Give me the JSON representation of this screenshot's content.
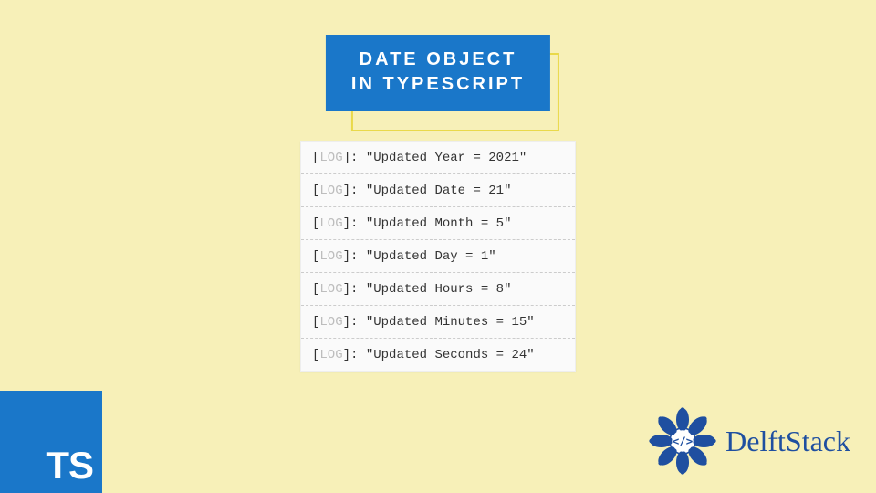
{
  "title": {
    "line1": "DATE OBJECT",
    "line2": "IN TYPESCRIPT"
  },
  "log_prefix_open": "[",
  "log_prefix_tag": "LOG",
  "log_prefix_close": "]",
  "log_colon": ": ",
  "logs": [
    "\"Updated Year = 2021\"",
    "\"Updated Date = 21\"",
    "\"Updated Month = 5\"",
    "\"Updated Day = 1\"",
    "\"Updated Hours = 8\"",
    "\"Updated Minutes = 15\"",
    "\"Updated Seconds = 24\""
  ],
  "ts_badge": "TS",
  "brand": "DelftStack",
  "colors": {
    "bg": "#f7f0b8",
    "accent": "#1a77c9",
    "brand_text": "#1f4fa0"
  }
}
